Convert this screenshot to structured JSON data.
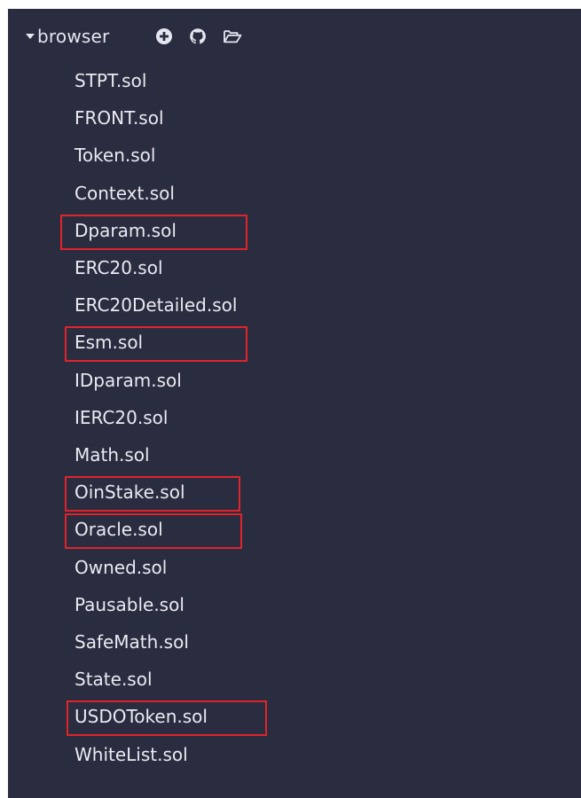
{
  "explorer": {
    "folder": {
      "name": "browser",
      "caret_icon": "caret-down-icon",
      "actions": [
        {
          "name": "new-file",
          "icon": "plus-circle-icon"
        },
        {
          "name": "github",
          "icon": "github-icon"
        },
        {
          "name": "open-folder",
          "icon": "folder-open-icon"
        }
      ]
    },
    "files": [
      {
        "label": "STPT.sol",
        "highlighted": false
      },
      {
        "label": "FRONT.sol",
        "highlighted": false
      },
      {
        "label": "Token.sol",
        "highlighted": false
      },
      {
        "label": "Context.sol",
        "highlighted": false
      },
      {
        "label": "Dparam.sol",
        "highlighted": true
      },
      {
        "label": "ERC20.sol",
        "highlighted": false
      },
      {
        "label": "ERC20Detailed.sol",
        "highlighted": false
      },
      {
        "label": "Esm.sol",
        "highlighted": true
      },
      {
        "label": "IDparam.sol",
        "highlighted": false
      },
      {
        "label": "IERC20.sol",
        "highlighted": false
      },
      {
        "label": "Math.sol",
        "highlighted": false
      },
      {
        "label": "OinStake.sol",
        "highlighted": true
      },
      {
        "label": "Oracle.sol",
        "highlighted": true
      },
      {
        "label": "Owned.sol",
        "highlighted": false
      },
      {
        "label": "Pausable.sol",
        "highlighted": false
      },
      {
        "label": "SafeMath.sol",
        "highlighted": false
      },
      {
        "label": "State.sol",
        "highlighted": false
      },
      {
        "label": "USDOToken.sol",
        "highlighted": true
      },
      {
        "label": "WhiteList.sol",
        "highlighted": false
      }
    ],
    "colors": {
      "panel_background": "#2a2c3f",
      "text": "#e9eaf2",
      "highlight_border": "#e0242a"
    }
  }
}
